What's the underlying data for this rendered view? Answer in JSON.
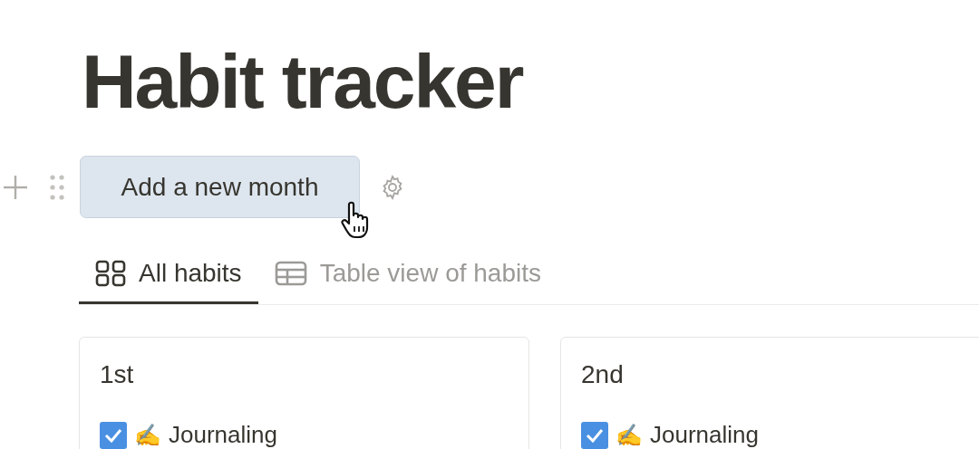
{
  "page": {
    "title": "Habit tracker"
  },
  "button": {
    "label": "Add a new month"
  },
  "tabs": [
    {
      "label": "All habits",
      "kind": "gallery",
      "selected": true
    },
    {
      "label": "Table view of habits",
      "kind": "table",
      "selected": false
    }
  ],
  "cards": [
    {
      "title": "1st",
      "habits": [
        {
          "emoji": "✍️",
          "label": "Journaling",
          "checked": true
        }
      ]
    },
    {
      "title": "2nd",
      "habits": [
        {
          "emoji": "✍️",
          "label": "Journaling",
          "checked": true
        }
      ]
    }
  ]
}
